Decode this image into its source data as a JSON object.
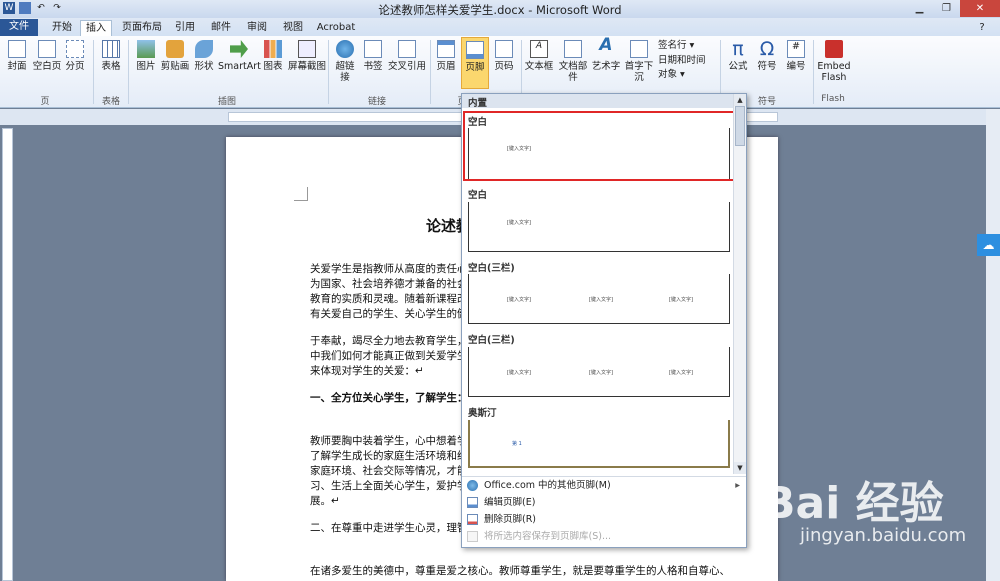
{
  "window": {
    "title": "论述教师怎样关爱学生.docx - Microsoft Word",
    "help": "?"
  },
  "tabs": [
    "文件",
    "开始",
    "插入",
    "页面布局",
    "引用",
    "邮件",
    "审阅",
    "视图",
    "Acrobat"
  ],
  "ribbon": {
    "buttons": [
      {
        "label": "封面",
        "icon": "cover-page-icon"
      },
      {
        "label": "空白页",
        "icon": "blank-page-icon"
      },
      {
        "label": "分页",
        "icon": "page-break-icon"
      },
      {
        "label": "表格",
        "icon": "table-icon"
      },
      {
        "label": "图片",
        "icon": "picture-icon"
      },
      {
        "label": "剪贴画",
        "icon": "clipart-icon"
      },
      {
        "label": "形状",
        "icon": "shapes-icon"
      },
      {
        "label": "SmartArt",
        "icon": "smartart-icon"
      },
      {
        "label": "图表",
        "icon": "chart-icon"
      },
      {
        "label": "屏幕截图",
        "icon": "screenshot-icon"
      },
      {
        "label": "超链接",
        "icon": "hyperlink-icon"
      },
      {
        "label": "书签",
        "icon": "bookmark-icon"
      },
      {
        "label": "交叉引用",
        "icon": "cross-reference-icon"
      },
      {
        "label": "页眉",
        "icon": "header-icon"
      },
      {
        "label": "页脚",
        "icon": "footer-icon"
      },
      {
        "label": "页码",
        "icon": "page-number-icon"
      },
      {
        "label": "文本框",
        "icon": "textbox-icon"
      },
      {
        "label": "文档部件",
        "icon": "quick-parts-icon"
      },
      {
        "label": "艺术字",
        "icon": "wordart-icon"
      },
      {
        "label": "首字下沉",
        "icon": "dropcap-icon"
      },
      {
        "label": "公式",
        "icon": "equation-icon"
      },
      {
        "label": "符号",
        "icon": "symbol-icon"
      },
      {
        "label": "编号",
        "icon": "number-icon"
      },
      {
        "label": "Embed Flash",
        "icon": "flash-icon"
      }
    ],
    "small": [
      "签名行",
      "日期和时间",
      "对象"
    ],
    "groups": [
      "页",
      "表格",
      "插图",
      "链接",
      "页",
      "符号",
      "Flash"
    ]
  },
  "dropdown": {
    "header": "内置",
    "items": [
      {
        "title": "空白",
        "hold": [
          "[键入文字]"
        ]
      },
      {
        "title": "空白",
        "hold": [
          "[键入文字]"
        ]
      },
      {
        "title": "空白(三栏)",
        "hold": [
          "[键入文字]",
          "[键入文字]",
          "[键入文字]"
        ]
      },
      {
        "title": "空白(三栏)",
        "hold": [
          "[键入文字]",
          "[键入文字]",
          "[键入文字]"
        ]
      },
      {
        "title": "奥斯汀",
        "hold": [
          "第 1"
        ]
      }
    ],
    "menu": [
      {
        "label": "Office.com 中的其他页脚(M)",
        "disabled": false
      },
      {
        "label": "编辑页脚(E)",
        "disabled": false
      },
      {
        "label": "删除页脚(R)",
        "disabled": false
      },
      {
        "label": "将所选内容保存到页脚库(S)...",
        "disabled": true
      }
    ]
  },
  "document": {
    "title": "论述教",
    "lines": [
      "关爱学生是指教师从高度的责任心和",
      "为国家、社会培养德才兼备的社会主",
      "教育的实质和灵魂。随着新课程改革",
      "有关爱自己的学生、关心学生的健康",
      "于奉献，竭尽全力地去教育学生，才",
      "中我们如何才能真正做到关爱学生呢",
      "来体现对学生的关爱：↵",
      "一、全方位关心学生，了解学生：↵",
      "教师要胸中装着学生，心中想着学生",
      "了解学生成长的家庭生活环境和经常",
      "家庭环境、社会交际等情况，才能恰",
      "习、生活上全面关心学生，爱护学生",
      "展。↵",
      "二、在尊重中走进学生心灵，理智公",
      "在诸多爱生的美德中，尊重是爱之核心。教师尊重学生，就是要尊重学生的人格和自尊心、"
    ]
  },
  "watermark": {
    "brand": "Bai 经验",
    "url": "jingyan.baidu.com"
  }
}
